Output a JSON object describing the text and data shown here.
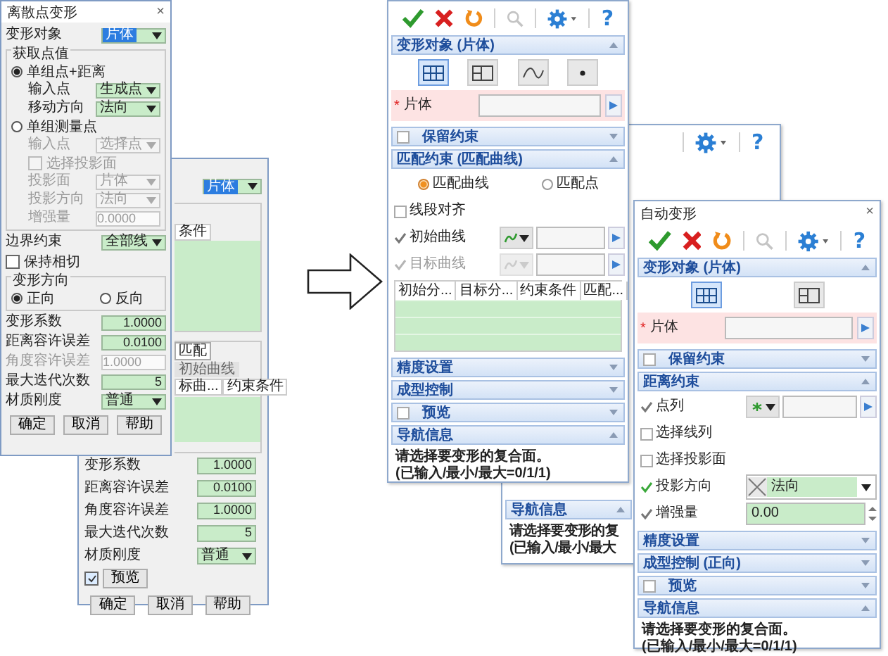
{
  "discrete_dialog": {
    "title": "离散点变形",
    "close": "×",
    "rows": [
      {
        "kind": "select",
        "label": "变形对象",
        "value": "片体",
        "selected": true,
        "disabled": false
      },
      {
        "kind": "group",
        "title": "获取点值",
        "rows": [
          {
            "kind": "radio",
            "label": "单组点+距离",
            "selected": true
          },
          {
            "kind": "select",
            "label": "输入点",
            "value": "生成点",
            "selected": false,
            "disabled": false
          },
          {
            "kind": "select",
            "label": "移动方向",
            "value": "法向",
            "selected": false,
            "disabled": false
          },
          {
            "kind": "radio",
            "label": "单组测量点",
            "selected": false
          },
          {
            "kind": "select",
            "label": "输入点",
            "value": "选择点",
            "selected": false,
            "disabled": true
          },
          {
            "kind": "checkbox",
            "label": "选择投影面",
            "checked": false,
            "disabled": true
          },
          {
            "kind": "select",
            "label": "投影面",
            "value": "片体",
            "selected": false,
            "disabled": true
          },
          {
            "kind": "select",
            "label": "投影方向",
            "value": "法向",
            "selected": false,
            "disabled": true
          },
          {
            "kind": "input",
            "label": "增强量",
            "value": "0.0000",
            "disabled": true
          }
        ]
      },
      {
        "kind": "select",
        "label": "边界约束",
        "value": "全部线",
        "selected": false,
        "disabled": false
      },
      {
        "kind": "checkbox",
        "label": "保持相切",
        "checked": false,
        "disabled": false
      },
      {
        "kind": "radiogroup",
        "title": "变形方向",
        "options": [
          {
            "label": "正向",
            "selected": true
          },
          {
            "label": "反向",
            "selected": false
          }
        ]
      },
      {
        "kind": "input",
        "label": "变形系数",
        "value": "1.0000",
        "disabled": false
      },
      {
        "kind": "input",
        "label": "距离容许误差",
        "value": "0.0100",
        "disabled": false
      },
      {
        "kind": "input",
        "label": "角度容许误差",
        "value": "1.0000",
        "disabled": true
      },
      {
        "kind": "input",
        "label": "最大迭代次数",
        "value": "5",
        "disabled": false
      },
      {
        "kind": "select",
        "label": "材质刚度",
        "value": "普通",
        "selected": false,
        "disabled": false
      }
    ],
    "buttons": [
      "确定",
      "取消",
      "帮助"
    ]
  },
  "back_dialog": {
    "select": {
      "value": "片体",
      "selected": true
    },
    "table_header": "条件",
    "tab": "匹配",
    "greyed_label": "初始曲线",
    "table_columns": [
      "标曲...",
      "约束条件"
    ],
    "rows": [
      {
        "kind": "input",
        "label": "变形系数",
        "value": "1.0000",
        "disabled": false
      },
      {
        "kind": "input",
        "label": "距离容许误差",
        "value": "0.0100",
        "disabled": false
      },
      {
        "kind": "input",
        "label": "角度容许误差",
        "value": "1.0000",
        "disabled": false
      },
      {
        "kind": "input",
        "label": "最大迭代次数",
        "value": "5",
        "disabled": false
      },
      {
        "kind": "select",
        "label": "材质刚度",
        "value": "普通",
        "selected": false,
        "disabled": false
      }
    ],
    "preview": {
      "checked": true,
      "label": "预览"
    },
    "buttons": [
      "确定",
      "取消",
      "帮助"
    ]
  },
  "match_panel": {
    "toolbar": [
      {
        "kind": "confirm"
      },
      {
        "kind": "cancel"
      },
      {
        "kind": "refresh"
      },
      {
        "kind": "search",
        "disabled": true
      },
      {
        "kind": "settings"
      },
      {
        "kind": "help",
        "glyph": "?"
      }
    ],
    "sections": [
      {
        "title": "变形对象 (片体)",
        "expanded": true,
        "items": [
          {
            "kind": "shape_buttons",
            "buttons": [
              {
                "kind": "grid",
                "selected": true
              },
              {
                "kind": "split",
                "selected": false
              },
              {
                "kind": "wave",
                "selected": false
              },
              {
                "kind": "dot",
                "selected": false
              }
            ]
          },
          {
            "kind": "required",
            "mark": "*",
            "label": "片体"
          }
        ]
      },
      {
        "title": "保留约束",
        "expanded": false,
        "checked": false
      },
      {
        "title": "匹配约束 (匹配曲线)",
        "expanded": true,
        "items": [
          {
            "kind": "radios",
            "options": [
              {
                "label": "匹配曲线",
                "selected": true
              },
              {
                "label": "匹配点",
                "selected": false
              }
            ]
          },
          {
            "kind": "checkbox",
            "label": "线段对齐",
            "checked": false
          },
          {
            "kind": "curve_picker",
            "label": "初始曲线",
            "ok": false,
            "disabled": false
          },
          {
            "kind": "curve_picker",
            "label": "目标曲线",
            "ok": false,
            "disabled": true
          },
          {
            "kind": "table",
            "columns": [
              "初始分...",
              "目标分...",
              "约束条件",
              "匹配..."
            ]
          }
        ]
      },
      {
        "title": "精度设置",
        "expanded": false
      },
      {
        "title": "成型控制",
        "expanded": false
      },
      {
        "title": "预览",
        "expanded": false,
        "checked": false
      },
      {
        "title": "导航信息",
        "expanded": true,
        "items": [
          {
            "kind": "text",
            "lines": [
              "请选择要变形的复合面。",
              "(已输入/最小/最大=0/1/1)"
            ]
          }
        ]
      }
    ]
  },
  "middle_panel": {
    "toolbar": [
      {
        "kind": "settings"
      },
      {
        "kind": "help",
        "glyph": "?"
      }
    ],
    "sections": [
      {
        "title": "导航信息",
        "expanded": true,
        "items": [
          {
            "kind": "text",
            "lines": [
              "请选择要变形的复",
              "(已输入/最小/最大"
            ]
          }
        ]
      }
    ]
  },
  "auto_panel": {
    "title": "自动变形",
    "close": "×",
    "toolbar": [
      {
        "kind": "confirm"
      },
      {
        "kind": "cancel"
      },
      {
        "kind": "refresh"
      },
      {
        "kind": "search",
        "disabled": true
      },
      {
        "kind": "settings"
      },
      {
        "kind": "help",
        "glyph": "?"
      }
    ],
    "sections": [
      {
        "title": "变形对象 (片体)",
        "expanded": true,
        "items": [
          {
            "kind": "shape_buttons",
            "buttons": [
              {
                "kind": "grid",
                "selected": true
              },
              {
                "kind": "split",
                "selected": false
              }
            ]
          },
          {
            "kind": "required",
            "mark": "*",
            "label": "片体"
          }
        ]
      },
      {
        "title": "保留约束",
        "expanded": false,
        "checked": false
      },
      {
        "title": "距离约束",
        "expanded": true,
        "items": [
          {
            "kind": "point_picker",
            "label": "点列",
            "ok": false,
            "disabled": false
          },
          {
            "kind": "checkbox",
            "label": "选择线列",
            "checked": false
          },
          {
            "kind": "checkbox",
            "label": "选择投影面",
            "checked": false
          },
          {
            "kind": "dropdown",
            "label": "投影方向",
            "value": "法向",
            "ok": true
          },
          {
            "kind": "spin",
            "label": "增强量",
            "value": "0.00",
            "ok": false
          }
        ]
      },
      {
        "title": "精度设置",
        "expanded": false
      },
      {
        "title": "成型控制 (正向)",
        "expanded": false
      },
      {
        "title": "预览",
        "expanded": false,
        "checked": false
      },
      {
        "title": "导航信息",
        "expanded": true,
        "items": [
          {
            "kind": "text",
            "lines": [
              "请选择要变形的复合面。",
              "(已输入/最小/最大=0/1/1)"
            ]
          }
        ]
      }
    ]
  }
}
